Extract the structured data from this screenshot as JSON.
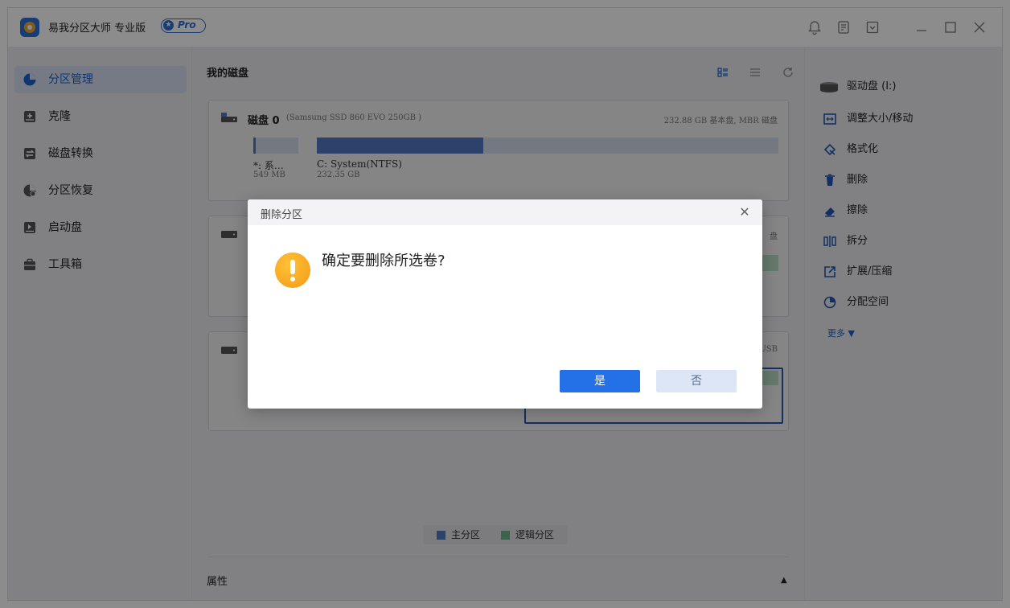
{
  "app": {
    "title": "易我分区大师 专业版",
    "badge": "Pro"
  },
  "sidebar": {
    "items": [
      {
        "label": "分区管理"
      },
      {
        "label": "克隆"
      },
      {
        "label": "磁盘转换"
      },
      {
        "label": "分区恢复"
      },
      {
        "label": "启动盘"
      },
      {
        "label": "工具箱"
      }
    ]
  },
  "main": {
    "header": "我的磁盘",
    "disk0": {
      "name": "磁盘 0",
      "model": "(Samsung SSD 860 EVO 250GB )",
      "info": "232.88 GB 基本盘, MBR 磁盘",
      "partitions": [
        {
          "label": "*: 系…",
          "size": "549 MB",
          "fill": 0.05
        },
        {
          "label": "C: System(NTFS)",
          "size": "232.35 GB",
          "fill": 0.36
        }
      ]
    },
    "disk1": {
      "info_tail": "盘"
    },
    "disk2": {
      "info_tail": "USB"
    },
    "legend": {
      "primary": "主分区",
      "logical": "逻辑分区"
    },
    "properties": "属性"
  },
  "right": {
    "items": [
      {
        "label": "驱动盘 (I:)"
      },
      {
        "label": "调整大小/移动"
      },
      {
        "label": "格式化"
      },
      {
        "label": "删除"
      },
      {
        "label": "擦除"
      },
      {
        "label": "拆分"
      },
      {
        "label": "扩展/压缩"
      },
      {
        "label": "分配空间"
      }
    ],
    "more": "更多 ▼"
  },
  "dialog": {
    "title": "删除分区",
    "message": "确定要删除所选卷?",
    "yes": "是",
    "no": "否"
  },
  "colors": {
    "accent": "#2470e6",
    "primary_partition": "#5279c4",
    "logical_partition": "#6fb38f",
    "warning": "#f4a62a"
  }
}
